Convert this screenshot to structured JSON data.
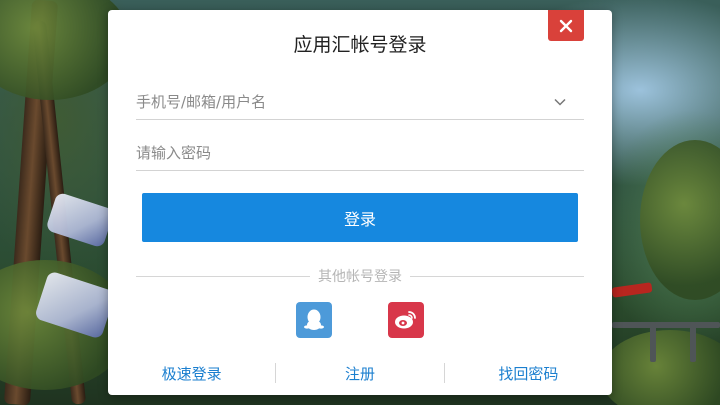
{
  "dialog": {
    "title": "应用汇帐号登录",
    "account_placeholder": "手机号/邮箱/用户名",
    "password_placeholder": "请输入密码",
    "login_label": "登录",
    "other_login_label": "其他帐号登录",
    "social": [
      {
        "name": "qq",
        "icon": "qq-penguin-icon",
        "color": "#4d9ad9"
      },
      {
        "name": "weibo",
        "icon": "weibo-icon",
        "color": "#d8374a"
      }
    ],
    "links": {
      "quick_login": "极速登录",
      "register": "注册",
      "recover_password": "找回密码"
    }
  },
  "colors": {
    "primary": "#1688df",
    "close": "#d9413a",
    "link": "#1b7fcf"
  }
}
